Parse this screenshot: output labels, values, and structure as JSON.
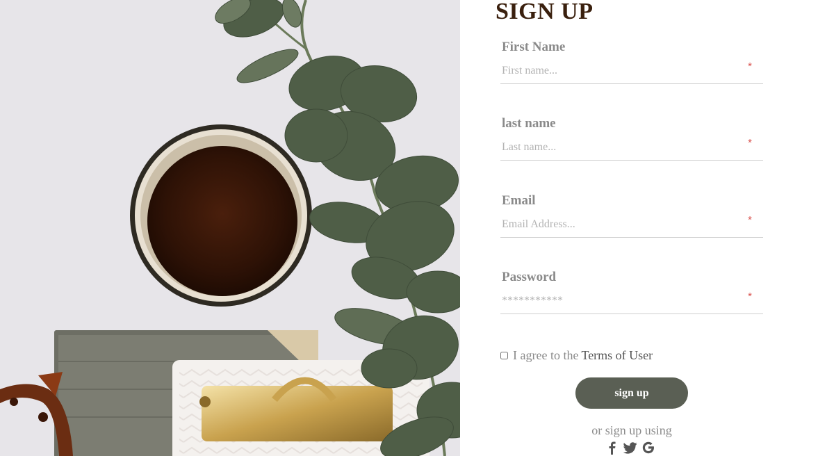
{
  "form": {
    "title": "SIGN UP",
    "fields": [
      {
        "label": "First Name",
        "placeholder": "First name...",
        "required_mark": "*"
      },
      {
        "label": "last name",
        "placeholder": "Last name...",
        "required_mark": "*"
      },
      {
        "label": "Email",
        "placeholder": "Email Address...",
        "required_mark": "*"
      },
      {
        "label": "Password",
        "placeholder": "***********",
        "required_mark": "*"
      }
    ],
    "agree_text": "I agree to the",
    "terms_link": "Terms of User",
    "submit_label": "sign up",
    "alt_signup_text": "or sign up using",
    "social_icons": [
      "facebook-icon",
      "twitter-icon",
      "google-icon"
    ]
  },
  "colors": {
    "title": "#3a200e",
    "label": "#8a8a8a",
    "button_bg": "#5a5f54",
    "required": "#d9534f"
  }
}
